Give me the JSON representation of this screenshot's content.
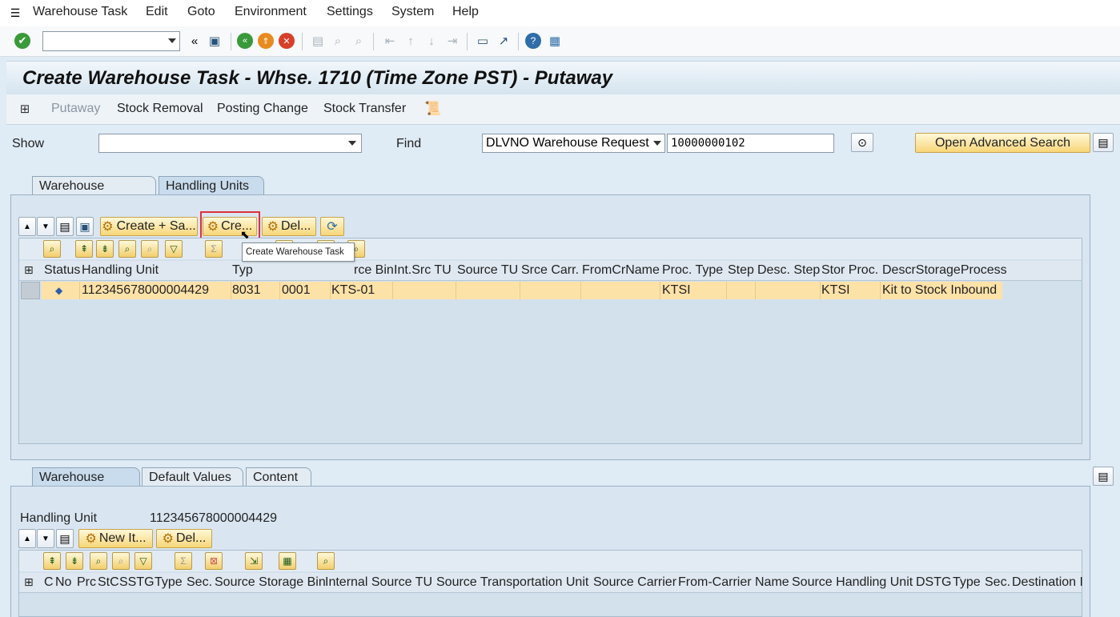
{
  "menu": [
    "Warehouse Task",
    "Edit",
    "Goto",
    "Environment",
    "Settings",
    "System",
    "Help"
  ],
  "title": "Create Warehouse Task - Whse. 1710 (Time Zone PST) - Putaway",
  "app_toolbar": [
    "Putaway",
    "Stock Removal",
    "Posting Change",
    "Stock Transfer"
  ],
  "show": {
    "label": "Show",
    "value": ""
  },
  "find": {
    "label": "Find",
    "type_value": "DLVNO Warehouse Request",
    "value": "10000000102"
  },
  "open_adv_search": "Open Advanced Search",
  "upper_tabs": [
    "Warehouse Request",
    "Handling Units"
  ],
  "hu_buttons": {
    "create_save": "Create + Sa...",
    "create": "Cre...",
    "delete": "Del..."
  },
  "tooltip": "Create Warehouse Task",
  "hu_table": {
    "columns": [
      "Status",
      "Handling Unit",
      "Typ",
      "",
      "rce Bin",
      "Int.Src TU",
      "Source TU",
      "Srce Carr.",
      "FromCrName",
      "Proc. Type",
      "Step",
      "Desc. Step",
      "Stor Proc.",
      "DescrStorageProcess"
    ],
    "rows": [
      {
        "status": "◆",
        "hu": "112345678000004429",
        "type": "8031",
        "col4": "0001",
        "bin": "KTS-01",
        "int_src_tu": "",
        "source_tu": "",
        "srce_carr": "",
        "fromcrname": "",
        "proc_type": "KTSI",
        "step": "",
        "desc_step": "",
        "stor_proc": "KTSI",
        "descr": "Kit to Stock Inbound"
      }
    ]
  },
  "lower_tabs": [
    "Warehouse Task",
    "Default Values",
    "Content"
  ],
  "handling_unit": {
    "label": "Handling Unit",
    "value": "112345678000004429"
  },
  "wt_buttons": {
    "new_item": "New It...",
    "delete": "Del..."
  },
  "wt_table": {
    "columns": [
      "C",
      "No",
      "Prc",
      "StC",
      "SSTG",
      "Type",
      "Sec.",
      "Source Storage Bin",
      "Internal Source TU",
      "Source Transportation Unit",
      "Source Carrier",
      "From-Carrier Name",
      "Source Handling Unit",
      "DSTG",
      "Type",
      "Sec.",
      "Destination I"
    ]
  },
  "colors": {
    "accent_yellow": "#f7d678",
    "row_highlight": "#fde2a8",
    "tooltip_border": "#e0303a"
  }
}
